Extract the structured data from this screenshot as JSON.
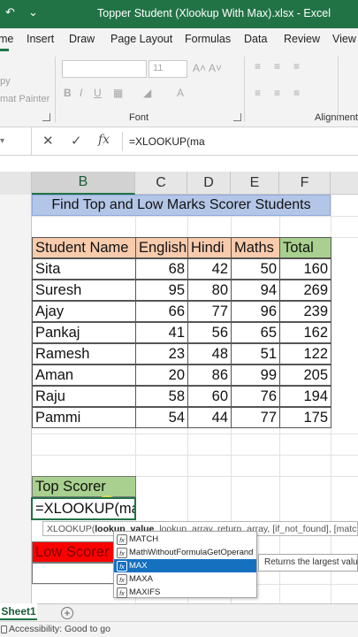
{
  "window": {
    "title": "Topper Student (Xlookup With Max).xlsx  -  Excel",
    "qat_more": "⌄"
  },
  "ribbon_tabs": [
    "me",
    "Insert",
    "Draw",
    "Page Layout",
    "Formulas",
    "Data",
    "Review",
    "View"
  ],
  "ribbon": {
    "clipboard_py": "py",
    "format_painter": "mat Painter",
    "font_size": "11",
    "font_group": "Font",
    "alignment_group": "Alignment",
    "grow_font": "A˄",
    "shrink_font": "A˅",
    "bold": "B",
    "italic": "I",
    "underline": "U"
  },
  "formula_bar": {
    "cancel": "✕",
    "enter": "✓",
    "fx": "fx",
    "content": "=XLOOKUP(ma"
  },
  "columns": [
    "B",
    "C",
    "D",
    "E",
    "F"
  ],
  "sheet": {
    "banner": "Find Top and Low Marks Scorer Students",
    "headers": [
      "Student Name",
      "English",
      "Hindi",
      "Maths",
      "Total"
    ],
    "rows": [
      [
        "Sita",
        "68",
        "42",
        "50",
        "160"
      ],
      [
        "Suresh",
        "95",
        "80",
        "94",
        "269"
      ],
      [
        "Ajay",
        "66",
        "77",
        "96",
        "239"
      ],
      [
        "Pankaj",
        "41",
        "56",
        "65",
        "162"
      ],
      [
        "Ramesh",
        "23",
        "48",
        "51",
        "122"
      ],
      [
        "Aman",
        "20",
        "86",
        "99",
        "205"
      ],
      [
        "Raju",
        "58",
        "60",
        "76",
        "194"
      ],
      [
        "Pammi",
        "54",
        "44",
        "77",
        "175"
      ]
    ],
    "top_scorer_label": "Top Scorer",
    "active_cell_text": "=XLOOKUP(ma",
    "low_scorer_label": "Low Scorer"
  },
  "tooltip": {
    "fn": "XLOOKUP(",
    "arg_current": "lookup_value",
    "rest": ", lookup_array, return_array, [if_not_found], [match_mode], [search_mode])"
  },
  "autocomplete": {
    "items": [
      "MATCH",
      "MathWithoutFormulaGetOperand",
      "MAX",
      "MAXA",
      "MAXIFS"
    ],
    "selected": "MAX",
    "description": "Returns the largest value in a set of values"
  },
  "sheet_tabs": {
    "active": "Sheet1",
    "add_label": "+"
  },
  "status": {
    "accessibility": "Accessibility: Good to go"
  }
}
